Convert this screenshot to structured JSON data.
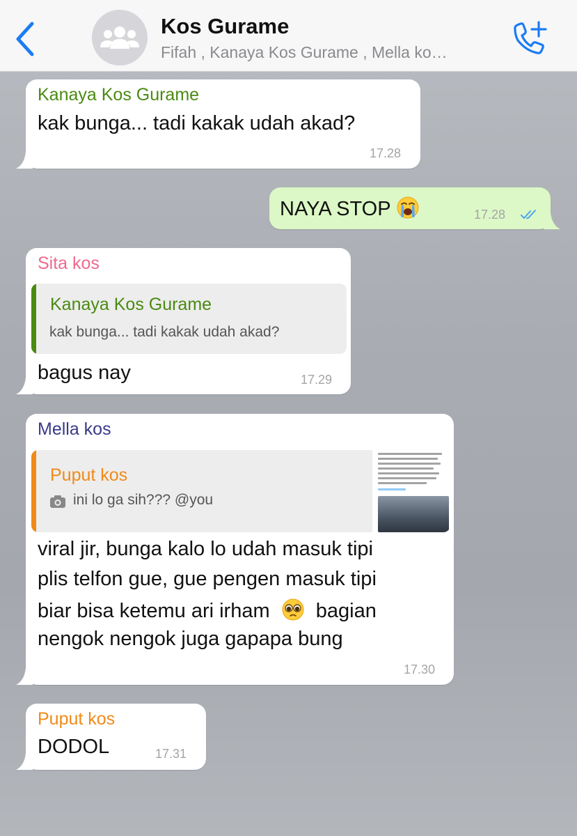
{
  "header": {
    "title": "Kos Gurame",
    "subtitle": "Fifah , Kanaya Kos Gurame , Mella ko…",
    "back_icon": "chevron-left-icon",
    "avatar_icon": "group-icon",
    "call_icon": "add-call-icon",
    "accent_color": "#1a7cf5"
  },
  "messages": [
    {
      "sender": "Kanaya Kos Gurame",
      "sender_color": "#4a8a12",
      "text": "kak bunga... tadi kakak udah akad?",
      "time": "17.28"
    },
    {
      "outgoing": true,
      "text": "NAYA STOP",
      "emoji": "loudly-crying-face",
      "time": "17.28",
      "status_icon": "double-check-icon",
      "status_color": "#4aa5f0"
    },
    {
      "sender": "Sita kos",
      "sender_color": "#ee6a8f",
      "quote": {
        "name": "Kanaya Kos Gurame",
        "name_color": "#4a8a12",
        "text": "kak bunga... tadi kakak udah akad?"
      },
      "text": "bagus nay",
      "time": "17.29"
    },
    {
      "sender": "Mella kos",
      "sender_color": "#3a3a8a",
      "quote": {
        "name": "Puput kos",
        "name_color": "#f08a18",
        "icon": "camera-icon",
        "text": "ini lo ga sih??? @you"
      },
      "lines": [
        "viral jir, bunga kalo lo udah masuk tipi",
        "plis telfon gue, gue pengen masuk tipi",
        "biar bisa ketemu ari irham",
        "bagian",
        "nengok nengok juga gapapa bung"
      ],
      "emoji": "pleading-face",
      "time": "17.30"
    },
    {
      "sender": "Puput kos",
      "sender_color": "#f08a18",
      "text": "DODOL",
      "time": "17.31"
    }
  ]
}
